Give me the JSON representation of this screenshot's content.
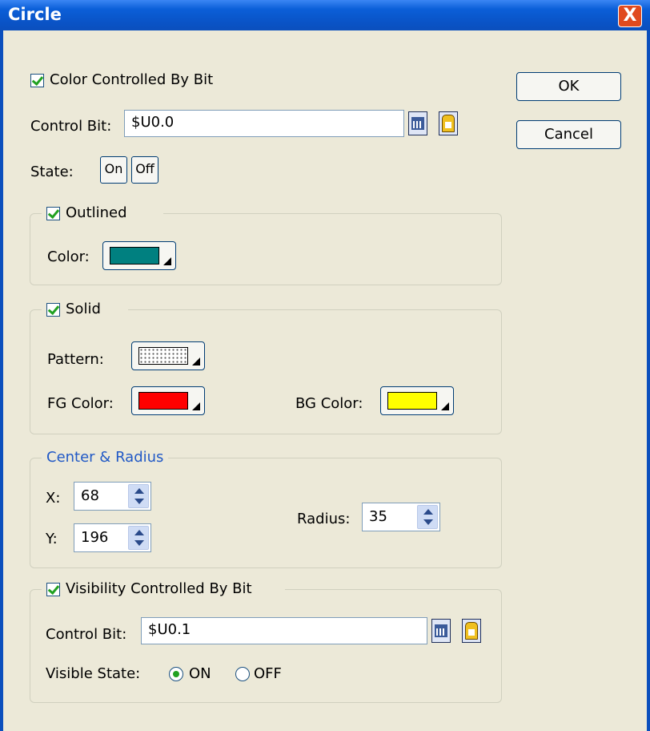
{
  "window": {
    "title": "Circle",
    "close_glyph": "X"
  },
  "color_controlled": {
    "label": "Color Controlled By Bit",
    "checked": true
  },
  "control_bit": {
    "label": "Control Bit:",
    "value": "$U0.0"
  },
  "state": {
    "label": "State:",
    "on": "On",
    "off": "Off"
  },
  "buttons": {
    "ok": "OK",
    "cancel": "Cancel"
  },
  "outlined": {
    "label": "Outlined",
    "checked": true,
    "color_label": "Color:",
    "color": "#008080"
  },
  "solid": {
    "label": "Solid",
    "checked": true,
    "pattern_label": "Pattern:",
    "fg_label": "FG Color:",
    "fg_color": "#ff0000",
    "bg_label": "BG Color:",
    "bg_color": "#ffff00"
  },
  "center_radius": {
    "label": "Center & Radius",
    "label_color": "#2159c6",
    "x_label": "X:",
    "x_value": "68",
    "y_label": "Y:",
    "y_value": "196",
    "radius_label": "Radius:",
    "radius_value": "35"
  },
  "visibility": {
    "label": "Visibility Controlled By Bit",
    "checked": true,
    "control_bit_label": "Control Bit:",
    "control_bit_value": "$U0.1",
    "visible_state_label": "Visible State:",
    "on_label": "ON",
    "off_label": "OFF",
    "selected": "ON"
  },
  "icons": {
    "calculator": "calculator-icon",
    "tag": "tag-browse-icon",
    "dropdown": "dropdown-arrow-icon",
    "spin": "spin-arrows-icon"
  }
}
